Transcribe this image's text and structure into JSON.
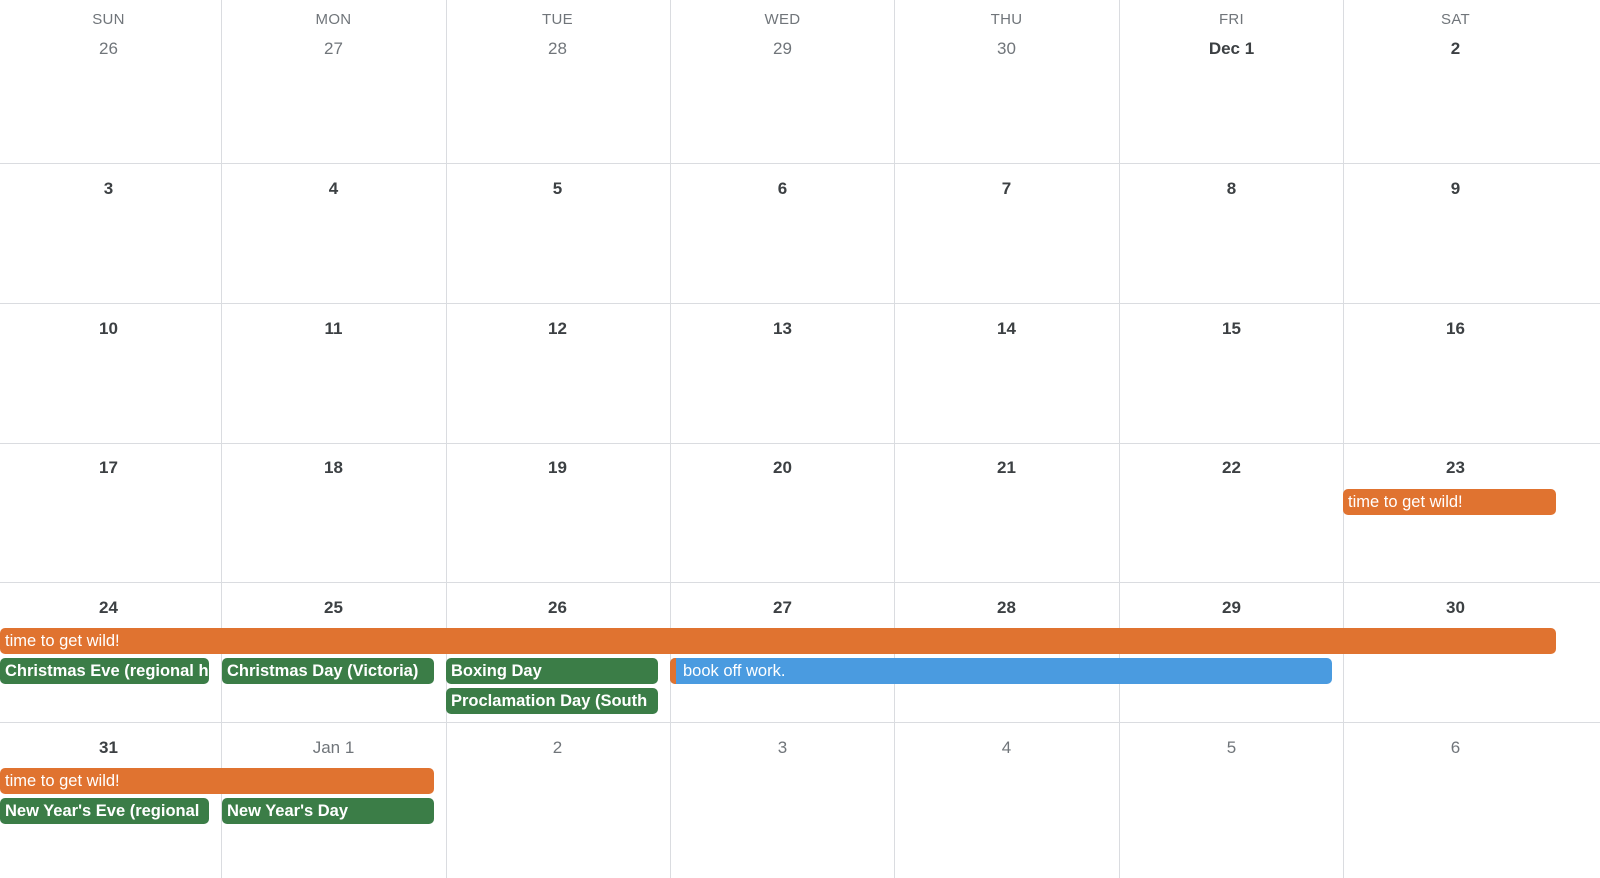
{
  "weekdays": [
    "SUN",
    "MON",
    "TUE",
    "WED",
    "THU",
    "FRI",
    "SAT"
  ],
  "weeks": [
    [
      "26",
      "27",
      "28",
      "29",
      "30",
      "Dec 1",
      "2"
    ],
    [
      "3",
      "4",
      "5",
      "6",
      "7",
      "8",
      "9"
    ],
    [
      "10",
      "11",
      "12",
      "13",
      "14",
      "15",
      "16"
    ],
    [
      "17",
      "18",
      "19",
      "20",
      "21",
      "22",
      "23"
    ],
    [
      "24",
      "25",
      "26",
      "27",
      "28",
      "29",
      "30"
    ],
    [
      "31",
      "Jan 1",
      "2",
      "3",
      "4",
      "5",
      "6"
    ]
  ],
  "events": {
    "wild_sat23": "time to get wild!",
    "wild_week5": "time to get wild!",
    "christmas_eve": "Christmas Eve (regional h",
    "christmas_day": "Christmas Day (Victoria)",
    "boxing_day": "Boxing Day",
    "book_off_work": "book off work.",
    "proclamation_day": "Proclamation Day (South",
    "wild_week6": "time to get wild!",
    "new_years_eve": "New Year's Eve (regional",
    "new_years_day": "New Year's Day"
  },
  "colors": {
    "orange": "#e07330",
    "green": "#3b7d47",
    "blue": "#4a9be0",
    "grid": "#dadce0"
  }
}
